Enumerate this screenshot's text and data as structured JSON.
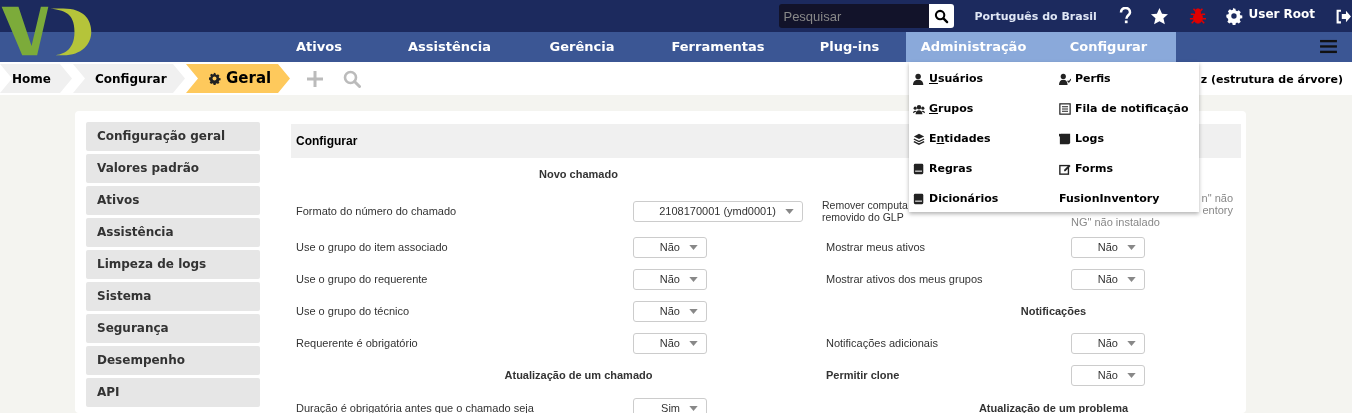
{
  "topbar": {
    "search": {
      "placeholder": "Pesquisar"
    },
    "language": "Português do Brasil",
    "user": "User Root"
  },
  "nav": [
    {
      "label": "Ativos",
      "selected": false
    },
    {
      "label": "Assistência",
      "selected": false
    },
    {
      "label": "Gerência",
      "selected": false
    },
    {
      "label": "Ferramentas",
      "selected": false
    },
    {
      "label": "Plug-ins",
      "selected": false
    },
    {
      "label": "Administração",
      "selected": true
    },
    {
      "label": "Configurar",
      "selected": true
    }
  ],
  "breadcrumbs": [
    {
      "label": "Home",
      "selected": false
    },
    {
      "label": "Configurar",
      "selected": false
    },
    {
      "label": "Geral",
      "selected": true
    }
  ],
  "entity": "z (estrutura de árvore)",
  "menu": [
    {
      "kind": "user",
      "key": "U",
      "after": "suários"
    },
    {
      "kind": "profile",
      "label": "Perfis"
    },
    {
      "kind": "group",
      "key": "G",
      "after": "rupos"
    },
    {
      "kind": "queue",
      "label": "Fila de notificação"
    },
    {
      "kind": "entity",
      "before": "E",
      "key": "n",
      "after": "tidades"
    },
    {
      "kind": "logs",
      "label": "Logs"
    },
    {
      "kind": "book",
      "label": "Regras"
    },
    {
      "kind": "forms",
      "label": "Forms"
    },
    {
      "kind": "book",
      "label": "Dicionários"
    },
    {
      "kind": "plain",
      "label": "FusionInventory"
    }
  ],
  "sidebar": {
    "items": [
      {
        "label": "Configuração geral",
        "selected": false
      },
      {
        "label": "Valores padrão",
        "selected": false
      },
      {
        "label": "Ativos",
        "selected": false
      },
      {
        "label": "Assistência",
        "selected": false
      },
      {
        "label": "Limpeza de logs",
        "selected": false
      },
      {
        "label": "Sistema",
        "selected": false
      },
      {
        "label": "Segurança",
        "selected": false
      },
      {
        "label": "Desempenho",
        "selected": false
      },
      {
        "label": "API",
        "selected": false
      }
    ]
  },
  "panel": {
    "title": "Configurar",
    "rows": [
      [
        {
          "kind": "section",
          "text": "Novo chamado"
        },
        {
          "kind": "blank"
        }
      ],
      [
        {
          "kind": "field",
          "label": "Formato do número do chamado",
          "value": "2108170001 (ymd0001)",
          "wide": true
        },
        {
          "kind": "note",
          "label_lines": [
            "Remover computa",
            "removido do GLP"
          ],
          "note_lines": [
            {
              "text": "n\" não",
              "clipped": true
            },
            {
              "text": "entory",
              "clipped": true
            },
            {
              "text": "NG\" não instalado",
              "clipped": false
            }
          ]
        }
      ],
      [
        {
          "kind": "field",
          "label": "Use o grupo do item associado",
          "value": "Não"
        },
        {
          "kind": "field",
          "label": "Mostrar meus ativos",
          "value": "Não"
        }
      ],
      [
        {
          "kind": "field",
          "label": "Use o grupo do requerente",
          "value": "Não"
        },
        {
          "kind": "field",
          "label": "Mostrar ativos dos meus grupos",
          "value": "Não"
        }
      ],
      [
        {
          "kind": "field",
          "label": "Use o grupo do técnico",
          "value": "Não"
        },
        {
          "kind": "section",
          "text": "Notificações"
        }
      ],
      [
        {
          "kind": "field",
          "label": "Requerente é obrigatório",
          "value": "Não"
        },
        {
          "kind": "field",
          "label": "Notificações adicionais",
          "value": "Não"
        }
      ],
      [
        {
          "kind": "section",
          "text": "Atualização de um chamado"
        },
        {
          "kind": "field",
          "label": "Permitir clone",
          "value": "Não",
          "bold": true
        }
      ],
      [
        {
          "kind": "field",
          "label": "Duração é obrigatória antes que o chamado seja",
          "value": "Sim"
        },
        {
          "kind": "section",
          "text": "Atualização de um problema"
        }
      ]
    ]
  }
}
